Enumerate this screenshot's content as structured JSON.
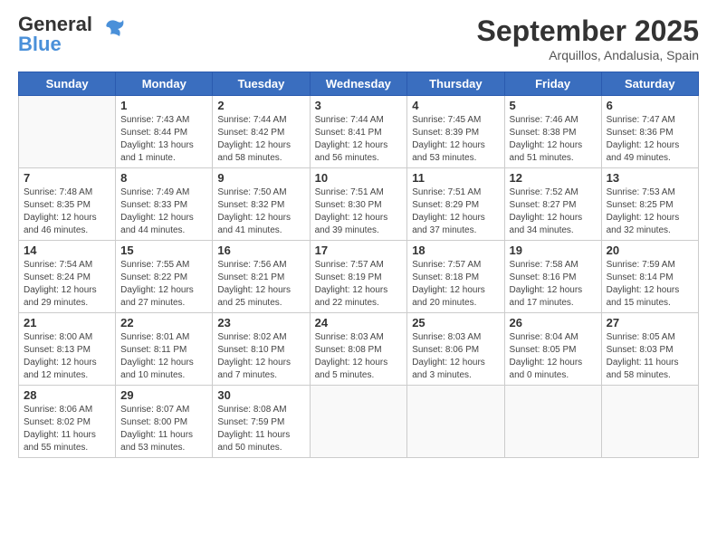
{
  "logo": {
    "line1": "General",
    "line2": "Blue"
  },
  "title": "September 2025",
  "location": "Arquillos, Andalusia, Spain",
  "weekdays": [
    "Sunday",
    "Monday",
    "Tuesday",
    "Wednesday",
    "Thursday",
    "Friday",
    "Saturday"
  ],
  "weeks": [
    [
      {
        "day": "",
        "info": ""
      },
      {
        "day": "1",
        "info": "Sunrise: 7:43 AM\nSunset: 8:44 PM\nDaylight: 13 hours\nand 1 minute."
      },
      {
        "day": "2",
        "info": "Sunrise: 7:44 AM\nSunset: 8:42 PM\nDaylight: 12 hours\nand 58 minutes."
      },
      {
        "day": "3",
        "info": "Sunrise: 7:44 AM\nSunset: 8:41 PM\nDaylight: 12 hours\nand 56 minutes."
      },
      {
        "day": "4",
        "info": "Sunrise: 7:45 AM\nSunset: 8:39 PM\nDaylight: 12 hours\nand 53 minutes."
      },
      {
        "day": "5",
        "info": "Sunrise: 7:46 AM\nSunset: 8:38 PM\nDaylight: 12 hours\nand 51 minutes."
      },
      {
        "day": "6",
        "info": "Sunrise: 7:47 AM\nSunset: 8:36 PM\nDaylight: 12 hours\nand 49 minutes."
      }
    ],
    [
      {
        "day": "7",
        "info": "Sunrise: 7:48 AM\nSunset: 8:35 PM\nDaylight: 12 hours\nand 46 minutes."
      },
      {
        "day": "8",
        "info": "Sunrise: 7:49 AM\nSunset: 8:33 PM\nDaylight: 12 hours\nand 44 minutes."
      },
      {
        "day": "9",
        "info": "Sunrise: 7:50 AM\nSunset: 8:32 PM\nDaylight: 12 hours\nand 41 minutes."
      },
      {
        "day": "10",
        "info": "Sunrise: 7:51 AM\nSunset: 8:30 PM\nDaylight: 12 hours\nand 39 minutes."
      },
      {
        "day": "11",
        "info": "Sunrise: 7:51 AM\nSunset: 8:29 PM\nDaylight: 12 hours\nand 37 minutes."
      },
      {
        "day": "12",
        "info": "Sunrise: 7:52 AM\nSunset: 8:27 PM\nDaylight: 12 hours\nand 34 minutes."
      },
      {
        "day": "13",
        "info": "Sunrise: 7:53 AM\nSunset: 8:25 PM\nDaylight: 12 hours\nand 32 minutes."
      }
    ],
    [
      {
        "day": "14",
        "info": "Sunrise: 7:54 AM\nSunset: 8:24 PM\nDaylight: 12 hours\nand 29 minutes."
      },
      {
        "day": "15",
        "info": "Sunrise: 7:55 AM\nSunset: 8:22 PM\nDaylight: 12 hours\nand 27 minutes."
      },
      {
        "day": "16",
        "info": "Sunrise: 7:56 AM\nSunset: 8:21 PM\nDaylight: 12 hours\nand 25 minutes."
      },
      {
        "day": "17",
        "info": "Sunrise: 7:57 AM\nSunset: 8:19 PM\nDaylight: 12 hours\nand 22 minutes."
      },
      {
        "day": "18",
        "info": "Sunrise: 7:57 AM\nSunset: 8:18 PM\nDaylight: 12 hours\nand 20 minutes."
      },
      {
        "day": "19",
        "info": "Sunrise: 7:58 AM\nSunset: 8:16 PM\nDaylight: 12 hours\nand 17 minutes."
      },
      {
        "day": "20",
        "info": "Sunrise: 7:59 AM\nSunset: 8:14 PM\nDaylight: 12 hours\nand 15 minutes."
      }
    ],
    [
      {
        "day": "21",
        "info": "Sunrise: 8:00 AM\nSunset: 8:13 PM\nDaylight: 12 hours\nand 12 minutes."
      },
      {
        "day": "22",
        "info": "Sunrise: 8:01 AM\nSunset: 8:11 PM\nDaylight: 12 hours\nand 10 minutes."
      },
      {
        "day": "23",
        "info": "Sunrise: 8:02 AM\nSunset: 8:10 PM\nDaylight: 12 hours\nand 7 minutes."
      },
      {
        "day": "24",
        "info": "Sunrise: 8:03 AM\nSunset: 8:08 PM\nDaylight: 12 hours\nand 5 minutes."
      },
      {
        "day": "25",
        "info": "Sunrise: 8:03 AM\nSunset: 8:06 PM\nDaylight: 12 hours\nand 3 minutes."
      },
      {
        "day": "26",
        "info": "Sunrise: 8:04 AM\nSunset: 8:05 PM\nDaylight: 12 hours\nand 0 minutes."
      },
      {
        "day": "27",
        "info": "Sunrise: 8:05 AM\nSunset: 8:03 PM\nDaylight: 11 hours\nand 58 minutes."
      }
    ],
    [
      {
        "day": "28",
        "info": "Sunrise: 8:06 AM\nSunset: 8:02 PM\nDaylight: 11 hours\nand 55 minutes."
      },
      {
        "day": "29",
        "info": "Sunrise: 8:07 AM\nSunset: 8:00 PM\nDaylight: 11 hours\nand 53 minutes."
      },
      {
        "day": "30",
        "info": "Sunrise: 8:08 AM\nSunset: 7:59 PM\nDaylight: 11 hours\nand 50 minutes."
      },
      {
        "day": "",
        "info": ""
      },
      {
        "day": "",
        "info": ""
      },
      {
        "day": "",
        "info": ""
      },
      {
        "day": "",
        "info": ""
      }
    ]
  ]
}
